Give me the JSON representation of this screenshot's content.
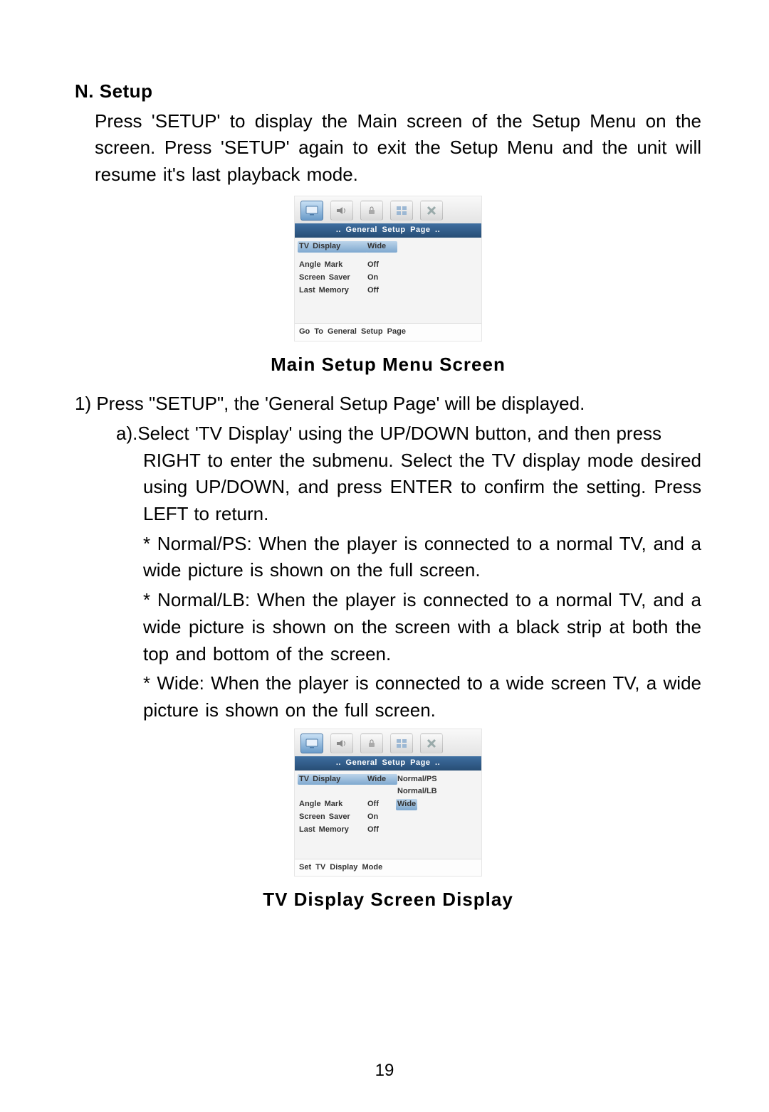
{
  "heading": "N.  Setup",
  "intro": "Press 'SETUP' to display the Main screen of the Setup Menu on the screen.  Press 'SETUP' again to exit the Setup Menu and the unit  will resume it's last playback mode.",
  "caption1": "Main  Setup  Menu  Screen",
  "step1": "1)  Press \"SETUP\", the 'General Setup Page' will be displayed.",
  "step_a_lead": "a).Select 'TV Display' using the UP/DOWN button, and then press",
  "step_a_rest": "RIGHT to enter the submenu. Select the TV display mode desired using UP/DOWN, and press ENTER to confirm the  setting. Press LEFT to return.",
  "bullet_ps": "* Normal/PS: When the player is connected to a normal TV, and a wide picture is shown on the full screen.",
  "bullet_lb": "* Normal/LB: When the player is connected to a normal TV, and a wide picture is shown on the screen with a black strip at both the top and bottom of the screen.",
  "bullet_wide": "* Wide: When the player is connected to a wide screen TV, a wide picture is shown on the full screen.",
  "caption2": "TV Display Screen Display",
  "page_number": "19",
  "menu1": {
    "title": "..   General  Setup  Page   ..",
    "rows": [
      {
        "label": "TV   Display",
        "value": "Wide",
        "selected": true
      },
      {
        "label": "",
        "value": ""
      },
      {
        "label": "Angle  Mark",
        "value": "Off"
      },
      {
        "label": "Screen  Saver",
        "value": "On"
      },
      {
        "label": "Last  Memory",
        "value": "Off"
      }
    ],
    "footer": "Go  To  General  Setup  Page"
  },
  "menu2": {
    "title": "..   General  Setup  Page   ..",
    "rows": [
      {
        "label": "TV   Display",
        "value": "Wide",
        "sub": [
          "Normal/PS",
          "Normal/LB",
          "Wide"
        ],
        "sub_selected": 2,
        "selected": true
      },
      {
        "label": "Angle  Mark",
        "value": "Off"
      },
      {
        "label": "Screen  Saver",
        "value": "On"
      },
      {
        "label": "Last  Memory",
        "value": "Off"
      }
    ],
    "footer": "Set  TV  Display  Mode"
  }
}
